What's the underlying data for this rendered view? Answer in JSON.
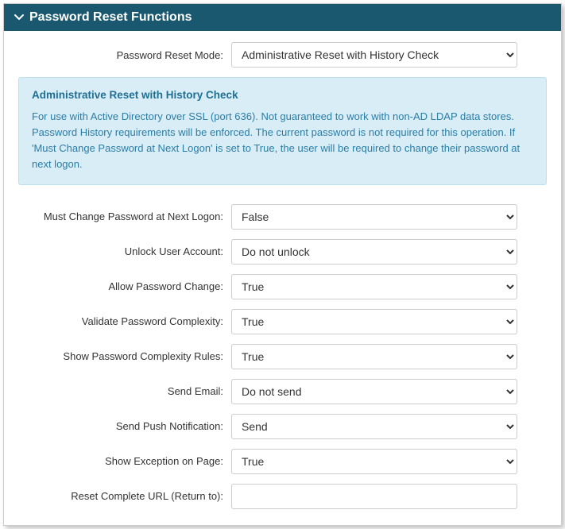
{
  "header": {
    "title": "Password Reset Functions"
  },
  "mode": {
    "label": "Password Reset Mode:",
    "value": "Administrative Reset with History Check"
  },
  "infobox": {
    "title": "Administrative Reset with History Check",
    "body": "For use with Active Directory over SSL (port 636). Not guaranteed to work with non-AD LDAP data stores. Password History requirements will be enforced. The current password is not required for this operation. If 'Must Change Password at Next Logon' is set to True, the user will be required to change their password at next logon."
  },
  "fields": {
    "mustChange": {
      "label": "Must Change Password at Next Logon:",
      "value": "False"
    },
    "unlock": {
      "label": "Unlock User Account:",
      "value": "Do not unlock"
    },
    "allowChange": {
      "label": "Allow Password Change:",
      "value": "True"
    },
    "validate": {
      "label": "Validate Password Complexity:",
      "value": "True"
    },
    "showRules": {
      "label": "Show Password Complexity Rules:",
      "value": "True"
    },
    "sendEmail": {
      "label": "Send Email:",
      "value": "Do not send"
    },
    "sendPush": {
      "label": "Send Push Notification:",
      "value": "Send"
    },
    "showExcept": {
      "label": "Show Exception on Page:",
      "value": "True"
    },
    "returnUrl": {
      "label": "Reset Complete URL (Return to):",
      "value": ""
    }
  }
}
